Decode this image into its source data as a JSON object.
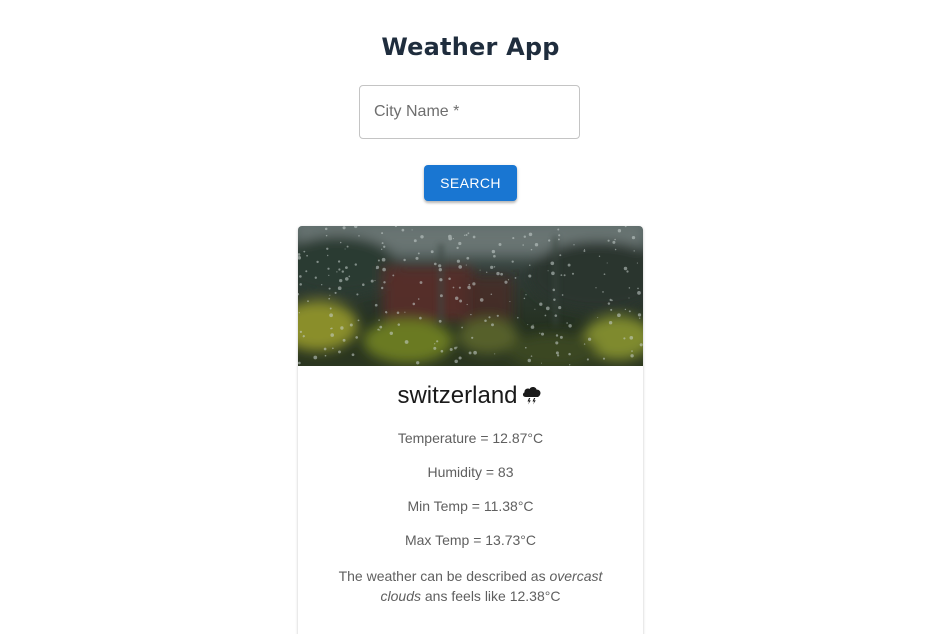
{
  "app": {
    "title": "Weather App"
  },
  "search": {
    "placeholder": "City Name *",
    "value": "",
    "button_label": "SEARCH"
  },
  "colors": {
    "primary": "#1976d2",
    "title": "#1f2d3d",
    "muted_text": "#5f5f5f"
  },
  "card": {
    "image_icon": "rainy-window-image",
    "city": "switzerland",
    "weather_icon": "thunderstorm-cloud-icon",
    "stats": {
      "temperature": "Temperature = 12.87°C",
      "humidity": "Humidity = 83",
      "min_temp": "Min Temp = 11.38°C",
      "max_temp": "Max Temp = 13.73°C"
    },
    "description": {
      "prefix": "The weather can be described as ",
      "condition": "overcast clouds",
      "middle": " ans feels like ",
      "feels_like": "12.38°C"
    }
  }
}
